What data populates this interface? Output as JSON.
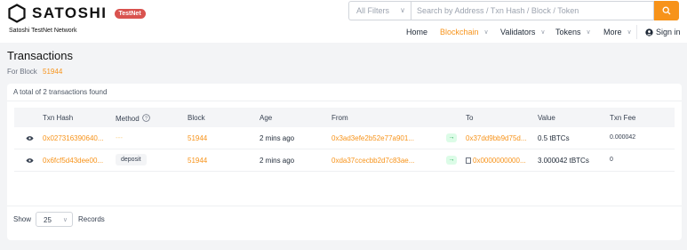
{
  "header": {
    "brand": "SATOSHI",
    "badge": "TestNet",
    "network": "Satoshi TestNet Network",
    "filter": {
      "value": "All Filters"
    },
    "search": {
      "placeholder": "Search by Address / Txn Hash / Block / Token"
    },
    "nav": [
      {
        "label": "Home",
        "active": false
      },
      {
        "label": "Blockchain",
        "active": true
      },
      {
        "label": "Validators",
        "active": false
      },
      {
        "label": "Tokens",
        "active": false
      },
      {
        "label": "More",
        "active": false
      }
    ],
    "sign_in": "Sign in",
    "accent": "#f7931a"
  },
  "page": {
    "title": "Transactions",
    "for_block_label": "For Block",
    "block_number": "51944"
  },
  "table": {
    "total_text": "A total of 2 transactions found",
    "columns": [
      "Txn Hash",
      "Method",
      "Block",
      "Age",
      "From",
      "To",
      "Value",
      "Txn Fee"
    ],
    "rows": [
      {
        "hash": "0x027316390640...",
        "method": "---",
        "block": "51944",
        "age": "2 mins ago",
        "from": "0x3ad3efe2b52e77a901...",
        "to": "0x37dd9bb9d75d...",
        "value": "0.5 tBTCs",
        "fee": "0.000042"
      },
      {
        "hash": "0x6fcf5d43dee00...",
        "method": "deposit",
        "block": "51944",
        "age": "2 mins ago",
        "from": "0xda37ccecbb2d7c83ae...",
        "to": "0x0000000000...",
        "value": "3.000042 tBTCs",
        "fee": "0"
      }
    ]
  },
  "pagination": {
    "show_label": "Show",
    "page_size": "25",
    "records_label": "Records"
  }
}
